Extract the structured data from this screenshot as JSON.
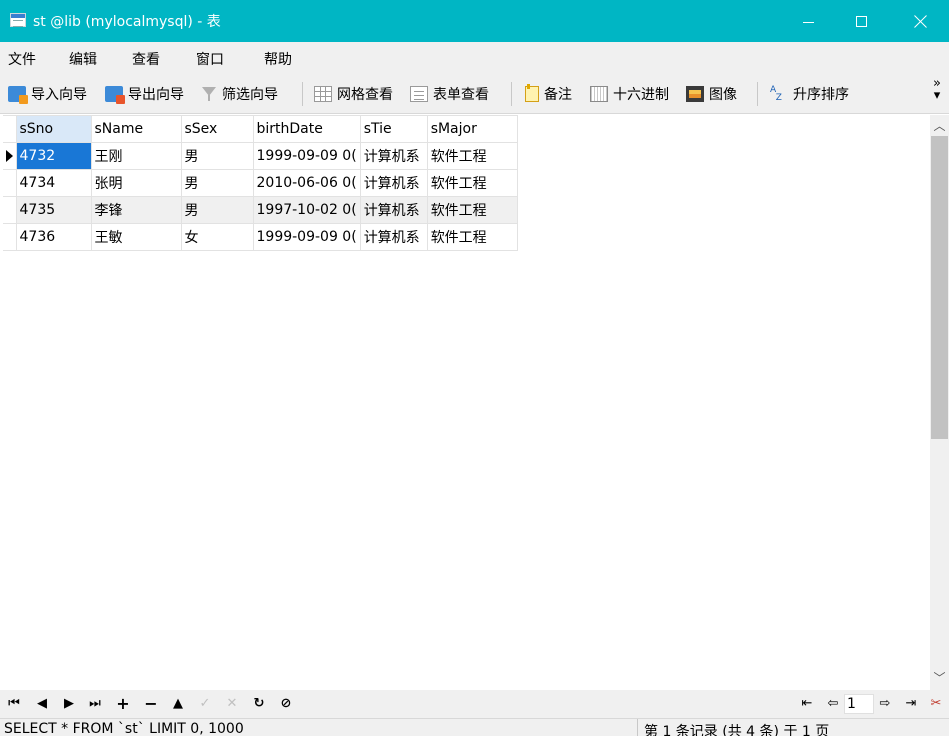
{
  "window": {
    "title": "st @lib (mylocalmysql) - 表"
  },
  "menu": {
    "items": [
      "文件",
      "编辑",
      "查看",
      "窗口",
      "帮助"
    ]
  },
  "toolbar": {
    "import_label": "导入向导",
    "export_label": "导出向导",
    "filter_label": "筛选向导",
    "grid_view_label": "网格查看",
    "form_view_label": "表单查看",
    "memo_label": "备注",
    "hex_label": "十六进制",
    "image_label": "图像",
    "sort_label": "升序排序",
    "more_label": "»"
  },
  "grid": {
    "columns": [
      "sSno",
      "sName",
      "sSex",
      "birthDate",
      "sTie",
      "sMajor"
    ],
    "rows": [
      [
        "4732",
        "王刚",
        "男",
        "1999-09-09 0(",
        "计算机系",
        "软件工程"
      ],
      [
        "4734",
        "张明",
        "男",
        "2010-06-06 0(",
        "计算机系",
        "软件工程"
      ],
      [
        "4735",
        "李锋",
        "男",
        "1997-10-02 0(",
        "计算机系",
        "软件工程"
      ],
      [
        "4736",
        "王敏",
        "女",
        "1999-09-09 0(",
        "计算机系",
        "软件工程"
      ]
    ],
    "selected_row": 0,
    "selected_col": 0
  },
  "nav": {
    "current_page": "1"
  },
  "status": {
    "sql": "SELECT * FROM `st` LIMIT 0, 1000",
    "record_info": "第 1 条记录 (共 4 条) 于 1 页"
  },
  "colors": {
    "titlebar": "#00b6c4",
    "selection": "#1977d6"
  }
}
